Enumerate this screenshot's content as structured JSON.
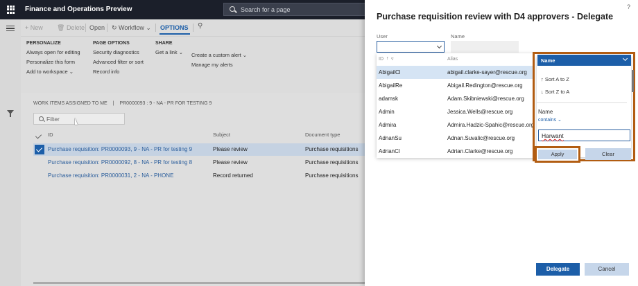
{
  "topbar": {
    "app_title": "Finance and Operations Preview",
    "search_placeholder": "Search for a page"
  },
  "actionpane": {
    "new": "New",
    "delete": "Delete",
    "open": "Open",
    "workflow": "Workflow",
    "options": "OPTIONS"
  },
  "ribbon": {
    "personalize": {
      "header": "PERSONALIZE",
      "items": [
        "Always open for editing",
        "Personalize this form",
        "Add to workspace"
      ]
    },
    "page_options": {
      "header": "PAGE OPTIONS",
      "items": [
        "Security diagnostics",
        "Advanced filter or sort",
        "Record info"
      ]
    },
    "share": {
      "header": "SHARE",
      "items": [
        "Get a link"
      ]
    },
    "alerts": {
      "items": [
        "Create a custom alert",
        "Manage my alerts"
      ]
    }
  },
  "workitems": {
    "breadcrumb": [
      "WORK ITEMS ASSIGNED TO ME",
      "|",
      "PR0000093 : 9 - NA - PR FOR TESTING 9"
    ],
    "filter_placeholder": "Filter",
    "columns": {
      "id": "ID",
      "subject": "Subject",
      "doctype": "Document type"
    },
    "rows": [
      {
        "id": "Purchase requisition: PR0000093, 9 - NA - PR for testing 9",
        "subject": "Please review",
        "doctype": "Purchase requisitions",
        "selected": true
      },
      {
        "id": "Purchase requisition: PR0000092, 8 - NA - PR for testing 8",
        "subject": "Please review",
        "doctype": "Purchase requisitions",
        "selected": false
      },
      {
        "id": "Purchase requisition: PR0000031, 2 - NA - PHONE",
        "subject": "Record returned",
        "doctype": "Purchase requisitions",
        "selected": false
      }
    ]
  },
  "dialog": {
    "title": "Purchase requisition review with D4 approvers - Delegate",
    "help": "?",
    "user_label": "User",
    "name_label": "Name",
    "lookup": {
      "col_id": "ID",
      "col_alias": "Alias",
      "rows": [
        {
          "id": "AbigailCl",
          "alias": "abigail.clarke-sayer@rescue.org"
        },
        {
          "id": "AbigailRe",
          "alias": "Abigail.Redington@rescue.org"
        },
        {
          "id": "adamsk",
          "alias": "Adam.Skibniewski@rescue.org"
        },
        {
          "id": "Admin",
          "alias": "Jessica.Wells@rescue.org"
        },
        {
          "id": "Admira",
          "alias": "Admira.Hadzic-Spahic@rescue.org"
        },
        {
          "id": "AdnanSu",
          "alias": "Adnan.Suvalic@rescue.org"
        },
        {
          "id": "AdrianCl",
          "alias": "Adrian.Clarke@rescue.org"
        }
      ]
    },
    "filter_panel": {
      "field": "Name",
      "sort_asc": "Sort A to Z",
      "sort_desc": "Sort Z to A",
      "field_label": "Name",
      "operator": "contains",
      "value": "Harwant",
      "apply": "Apply",
      "clear": "Clear"
    },
    "delegate": "Delegate",
    "cancel": "Cancel"
  },
  "colors": {
    "accent": "#1c5ea8",
    "highlight_box": "#b25d12",
    "topbar": "#1b1f2a"
  }
}
